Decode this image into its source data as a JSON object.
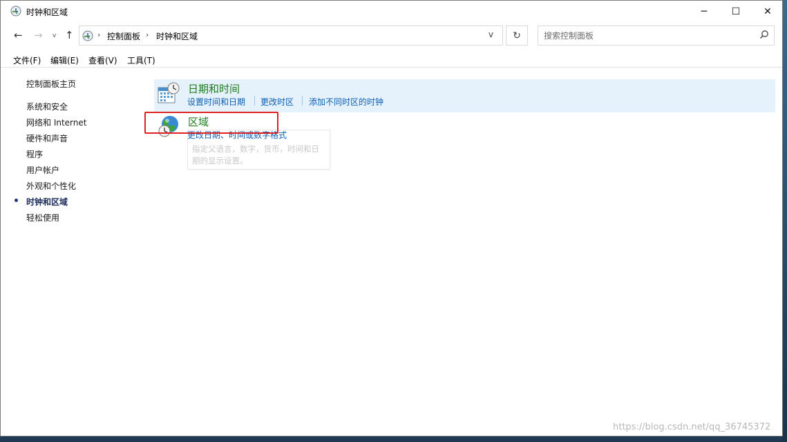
{
  "window": {
    "title": "时钟和区域",
    "controls": {
      "minimize": "─",
      "maximize": "☐",
      "close": "✕"
    }
  },
  "navigation": {
    "back": "←",
    "forward": "→",
    "recent": "v",
    "up": "↑",
    "breadcrumb": [
      "控制面板",
      "时钟和区域"
    ],
    "separator": "›",
    "dropdown": "v",
    "refresh": "↻"
  },
  "search": {
    "placeholder": "搜索控制面板"
  },
  "menu": [
    "文件(F)",
    "编辑(E)",
    "查看(V)",
    "工具(T)"
  ],
  "sidebar": {
    "home": "控制面板主页",
    "items": [
      "系统和安全",
      "网络和 Internet",
      "硬件和声音",
      "程序",
      "用户帐户",
      "外观和个性化",
      "时钟和区域",
      "轻松使用"
    ],
    "current": "时钟和区域"
  },
  "categories": [
    {
      "title": "日期和时间",
      "icon": "calendar-clock-icon",
      "links": [
        "设置时间和日期",
        "更改时区",
        "添加不同时区的时钟"
      ]
    },
    {
      "title": "区域",
      "icon": "globe-clock-icon",
      "links": [
        "更改日期、时间或数字格式"
      ]
    }
  ],
  "tooltip": {
    "text": "指定父语言，数字，货币，时间和日期的显示设置。"
  },
  "watermark": "https://blog.csdn.net/qq_36745372",
  "colors": {
    "category_title": "#1e7b1e",
    "link": "#0b5fb5",
    "hover_bg": "#e5f1fb",
    "highlight": "#e02020"
  }
}
